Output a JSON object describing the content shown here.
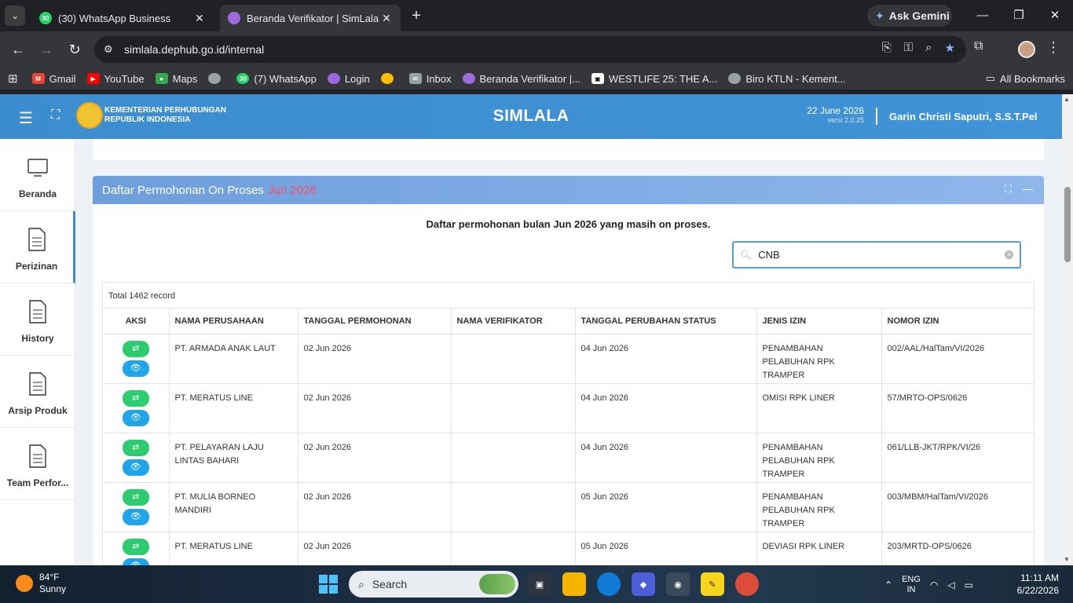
{
  "browser": {
    "tabs": [
      {
        "title": "(30) WhatsApp Business",
        "badge": "30",
        "active": false
      },
      {
        "title": "Beranda Verifikator | SimLala",
        "active": true
      }
    ],
    "gemini_label": "Ask Gemini",
    "url": "simlala.dephub.go.id/internal",
    "bookmarks": [
      {
        "label": "Gmail",
        "color": "#ea4335"
      },
      {
        "label": "YouTube",
        "color": "#ff0000"
      },
      {
        "label": "Maps",
        "color": "#34a853"
      },
      {
        "label": "",
        "color": "#9aa0a6"
      },
      {
        "label": "(7) WhatsApp",
        "badge": "30",
        "color": "#25d366"
      },
      {
        "label": "Login",
        "color": "#9c6ade"
      },
      {
        "label": "",
        "color": "#fbbc04"
      },
      {
        "label": "Inbox",
        "color": "#9aa0a6"
      },
      {
        "label": "Beranda Verifikator |...",
        "color": "#9c6ade"
      },
      {
        "label": "WESTLIFE 25: THE A...",
        "color": "#ffffff"
      },
      {
        "label": "Biro KTLN - Kement...",
        "color": "#9aa0a6"
      }
    ],
    "all_bookmarks": "All Bookmarks"
  },
  "header": {
    "ministry_line1": "KEMENTERIAN PERHUBUNGAN",
    "ministry_line2": "REPUBLIK INDONESIA",
    "app_title": "SIMLALA",
    "date": "22 June 2026",
    "version": "versi 2.0.25",
    "user": "Garin Christi Saputri, S.S.T.Pel"
  },
  "sidebar": {
    "items": [
      {
        "label": "Beranda",
        "icon": "monitor-icon"
      },
      {
        "label": "Perizinan",
        "icon": "document-icon"
      },
      {
        "label": "History",
        "icon": "document-icon"
      },
      {
        "label": "Arsip Produk",
        "icon": "document-icon"
      },
      {
        "label": "Team Perfor...",
        "icon": "document-icon"
      }
    ]
  },
  "card": {
    "title": "Daftar Permohonan On Proses",
    "month": "Jun 2026",
    "subtitle": "Daftar permohonan bulan Jun 2026 yang masih on proses.",
    "search_value": "CNB",
    "total": "Total 1462 record"
  },
  "table": {
    "headers": [
      "AKSI",
      "NAMA PERUSAHAAN",
      "TANGGAL PERMOHONAN",
      "NAMA VERIFIKATOR",
      "TANGGAL PERUBAHAN STATUS",
      "JENIS IZIN",
      "NOMOR IZIN"
    ],
    "rows": [
      [
        "PT. ARMADA ANAK LAUT",
        "02 Jun 2026",
        "",
        "04 Jun 2026",
        "PENAMBAHAN PELABUHAN RPK TRAMPER",
        "002/AAL/HalTam/VI/2026"
      ],
      [
        "PT. MERATUS LINE",
        "02 Jun 2026",
        "",
        "04 Jun 2026",
        "OMISI RPK LINER",
        "57/MRTO-OPS/0626"
      ],
      [
        "PT. PELAYARAN LAJU LINTAS BAHARI",
        "02 Jun 2026",
        "",
        "04 Jun 2026",
        "PENAMBAHAN PELABUHAN RPK TRAMPER",
        "061/LLB-JKT/RPK/VI/26"
      ],
      [
        "PT. MULIA BORNEO MANDIRI",
        "02 Jun 2026",
        "",
        "05 Jun 2026",
        "PENAMBAHAN PELABUHAN RPK TRAMPER",
        "003/MBM/HalTam/VI/2026"
      ],
      [
        "PT. MERATUS LINE",
        "02 Jun 2026",
        "",
        "05 Jun 2026",
        "DEVIASI RPK LINER",
        "203/MRTD-OPS/0626"
      ]
    ]
  },
  "taskbar": {
    "temperature": "84°F",
    "condition": "Sunny",
    "search_placeholder": "Search",
    "lang1": "ENG",
    "lang2": "IN",
    "time": "11:11 AM",
    "date": "6/22/2026"
  }
}
